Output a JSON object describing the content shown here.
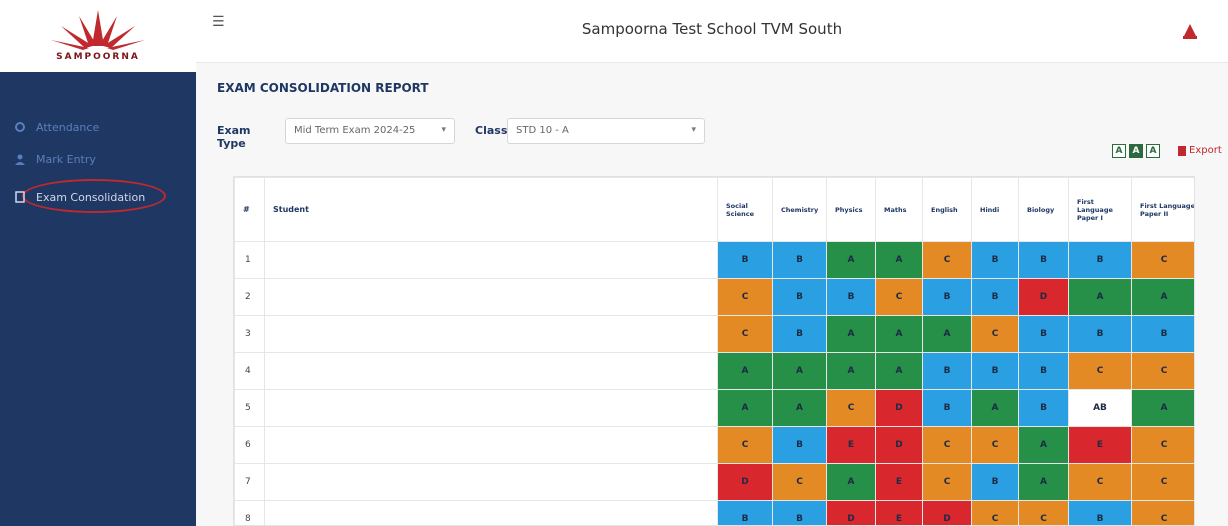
{
  "sidebar": {
    "brand": "SAMPOORNA",
    "items": [
      {
        "label": "Attendance",
        "icon": "gear-icon"
      },
      {
        "label": "Mark Entry",
        "icon": "user-icon"
      },
      {
        "label": "Exam Consolidation",
        "icon": "document-icon"
      }
    ]
  },
  "header": {
    "menu_icon": "hamburger-icon",
    "school_name": "Sampoorna Test School TVM South",
    "avatar_icon": "avatar-icon"
  },
  "report": {
    "title": "EXAM CONSOLIDATION REPORT",
    "filters": {
      "exam_type_label": "Exam Type",
      "exam_type_value": "Mid Term Exam 2024-25",
      "class_label": "Class",
      "class_value": "STD 10 - A"
    },
    "font_sizes": [
      "A",
      "A",
      "A"
    ],
    "export_label": "Export"
  },
  "table": {
    "headers": {
      "index": "#",
      "student": "Student",
      "subjects": [
        "Social Science",
        "Chemistry",
        "Physics",
        "Maths",
        "English",
        "Hindi",
        "Biology",
        "First Language Paper I",
        "First Language Paper II"
      ]
    },
    "rows": [
      {
        "n": "1",
        "student": "",
        "grades": [
          "B",
          "B",
          "A",
          "A",
          "C",
          "B",
          "B",
          "B",
          "C"
        ]
      },
      {
        "n": "2",
        "student": "",
        "grades": [
          "C",
          "B",
          "B",
          "C",
          "B",
          "B",
          "D",
          "A",
          "A"
        ]
      },
      {
        "n": "3",
        "student": "",
        "grades": [
          "C",
          "B",
          "A",
          "A",
          "A",
          "C",
          "B",
          "B",
          "B"
        ]
      },
      {
        "n": "4",
        "student": "",
        "grades": [
          "A",
          "A",
          "A",
          "A",
          "B",
          "B",
          "B",
          "C",
          "C"
        ]
      },
      {
        "n": "5",
        "student": "",
        "grades": [
          "A",
          "A",
          "C",
          "D",
          "B",
          "A",
          "B",
          "AB",
          "A"
        ]
      },
      {
        "n": "6",
        "student": "",
        "grades": [
          "C",
          "B",
          "E",
          "D",
          "C",
          "C",
          "A",
          "E",
          "C"
        ]
      },
      {
        "n": "7",
        "student": "",
        "grades": [
          "D",
          "C",
          "A",
          "E",
          "C",
          "B",
          "A",
          "C",
          "C"
        ]
      },
      {
        "n": "8",
        "student": "",
        "grades": [
          "B",
          "B",
          "D",
          "E",
          "D",
          "C",
          "C",
          "B",
          "C"
        ]
      }
    ]
  },
  "colors": {
    "sidebar": "#1f3763",
    "grade_A": "#269048",
    "grade_B": "#2aa0e2",
    "grade_C": "#e38a24",
    "grade_D": "#d8282e",
    "grade_E": "#d8282e",
    "highlight_oval": "#c0292e"
  }
}
